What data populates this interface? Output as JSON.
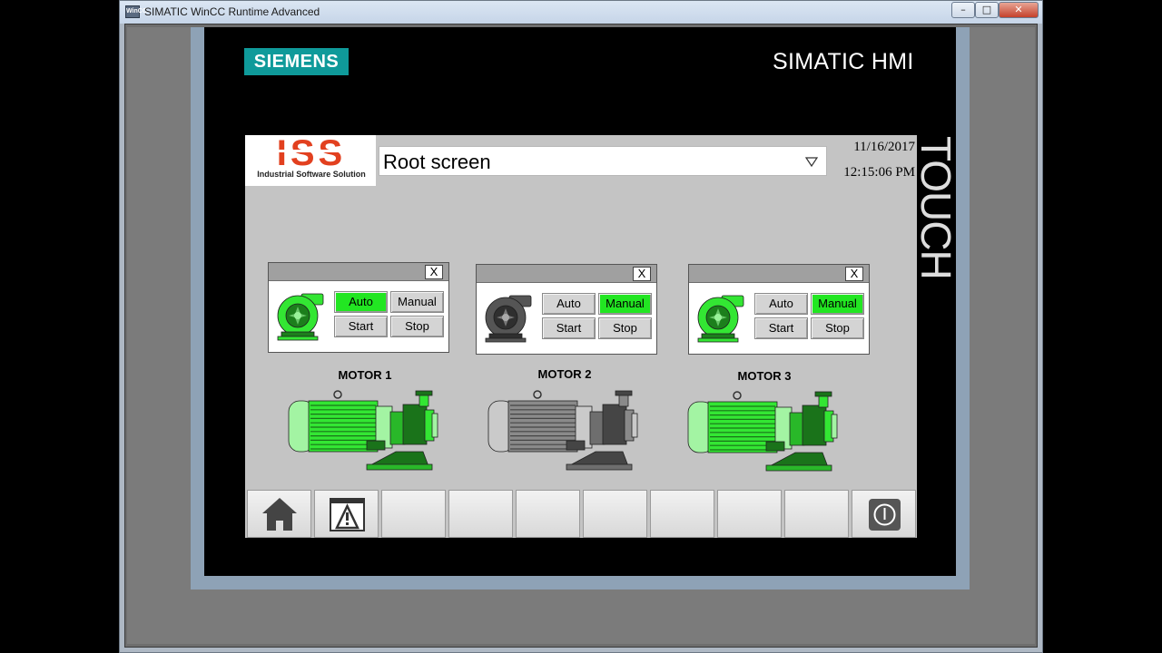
{
  "window": {
    "title": "SIMATIC WinCC Runtime Advanced",
    "icon_text": "WinCC",
    "buttons": [
      "minimize-icon",
      "maximize-icon",
      "close-icon"
    ]
  },
  "panel": {
    "brand": "SIEMENS",
    "product": "SIMATIC HMI",
    "touch_label": "TOUCH"
  },
  "header": {
    "logo_text": "ISS",
    "logo_subtitle": "Industrial Software Solution",
    "screen_selector": "Root screen",
    "date": "11/16/2017",
    "time": "12:15:06 PM"
  },
  "faceplates": [
    {
      "mode": "Auto",
      "pump_color": "#33e633",
      "buttons": {
        "auto": "Auto",
        "manual": "Manual",
        "start": "Start",
        "stop": "Stop"
      },
      "close": "X"
    },
    {
      "mode": "Manual",
      "pump_color": "#555555",
      "buttons": {
        "auto": "Auto",
        "manual": "Manual",
        "start": "Start",
        "stop": "Stop"
      },
      "close": "X"
    },
    {
      "mode": "Manual",
      "pump_color": "#33e633",
      "buttons": {
        "auto": "Auto",
        "manual": "Manual",
        "start": "Start",
        "stop": "Stop"
      },
      "close": "X"
    }
  ],
  "motors": [
    {
      "label": "MOTOR 1",
      "state": "running",
      "color": "#33e633"
    },
    {
      "label": "MOTOR 2",
      "state": "stopped",
      "color": "#8a8a8a"
    },
    {
      "label": "MOTOR 3",
      "state": "running",
      "color": "#33e633"
    }
  ],
  "function_keys": [
    {
      "icon": "home-icon"
    },
    {
      "icon": "alarm-warning-icon"
    },
    {
      "icon": ""
    },
    {
      "icon": ""
    },
    {
      "icon": ""
    },
    {
      "icon": ""
    },
    {
      "icon": ""
    },
    {
      "icon": ""
    },
    {
      "icon": ""
    },
    {
      "icon": "power-icon"
    }
  ],
  "colors": {
    "active_button": "#22e622",
    "siemens_teal": "#0f9a9a",
    "iss_red": "#e2401f"
  }
}
